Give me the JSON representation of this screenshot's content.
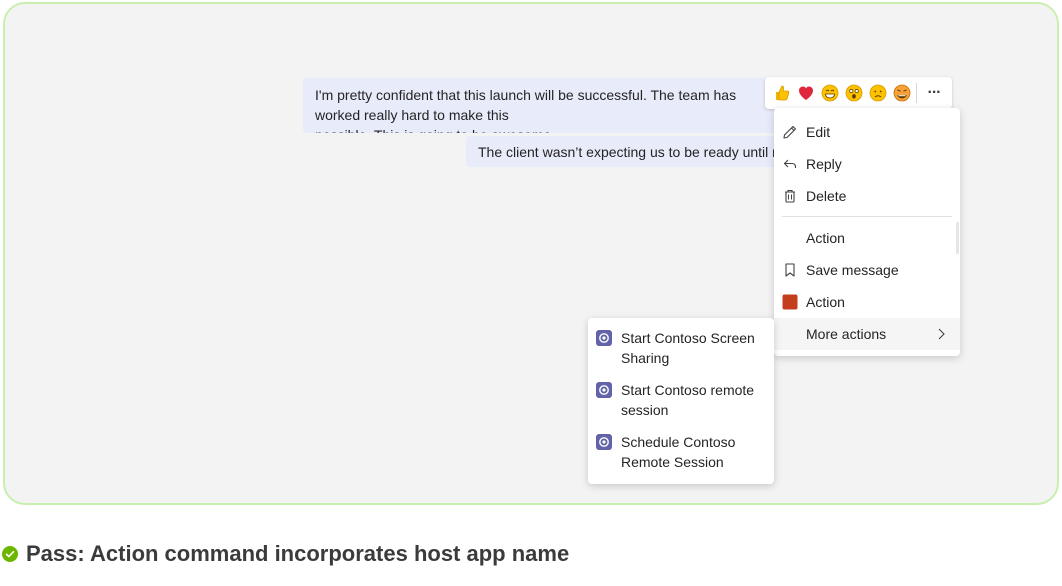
{
  "messages": [
    {
      "text": "I'm pretty confident that this launch will be successful. The team has worked really hard to make this\npossible. This is going to be awesome."
    },
    {
      "text": "The client wasn’t expecting us to be ready until next week."
    }
  ],
  "reactions": [
    "thumbs-up",
    "heart",
    "laugh",
    "surprised",
    "sad",
    "angry"
  ],
  "more_options_label": "···",
  "context_menu": {
    "items": [
      {
        "label": "Edit",
        "icon": "pencil-icon"
      },
      {
        "label": "Reply",
        "icon": "reply-icon"
      },
      {
        "label": "Delete",
        "icon": "trash-icon"
      },
      {
        "label": "Action",
        "icon": ""
      },
      {
        "label": "Save message",
        "icon": "bookmark-icon"
      },
      {
        "label": "Action",
        "icon": "app-square-icon",
        "icon_color": "#c43e1c"
      },
      {
        "label": "More actions",
        "icon": "chevron-right-icon"
      }
    ]
  },
  "submenu": {
    "items": [
      {
        "label": "Start Contoso Screen Sharing"
      },
      {
        "label": "Start Contoso remote session"
      },
      {
        "label": "Schedule Contoso Remote Session"
      }
    ],
    "icon_color": "#6264a7"
  },
  "caption": {
    "text": "Pass: Action command incorporates host app name",
    "status_color": "#6bb700"
  }
}
